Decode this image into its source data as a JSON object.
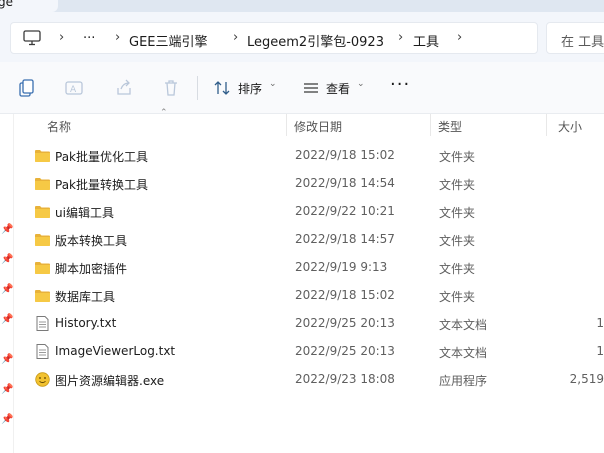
{
  "window": {
    "tab_title": "ge"
  },
  "address": {
    "more": "···",
    "crumbs": [
      "GEE三端引擎",
      "Legeem2引擎包-0923",
      "工具"
    ],
    "search_placeholder": "在 工具"
  },
  "toolbar": {
    "sort": "排序",
    "view": "查看",
    "more": "···"
  },
  "columns": {
    "name": "名称",
    "date": "修改日期",
    "type": "类型",
    "size": "大小"
  },
  "files": [
    {
      "icon": "folder-icon",
      "name": "Pak批量优化工具",
      "date": "2022/9/18 15:02",
      "type": "文件夹",
      "size": ""
    },
    {
      "icon": "folder-icon",
      "name": "Pak批量转换工具",
      "date": "2022/9/18 14:54",
      "type": "文件夹",
      "size": ""
    },
    {
      "icon": "folder-icon",
      "name": "ui编辑工具",
      "date": "2022/9/22 10:21",
      "type": "文件夹",
      "size": ""
    },
    {
      "icon": "folder-icon",
      "name": "版本转换工具",
      "date": "2022/9/18 14:57",
      "type": "文件夹",
      "size": ""
    },
    {
      "icon": "folder-icon",
      "name": "脚本加密插件",
      "date": "2022/9/19 9:13",
      "type": "文件夹",
      "size": ""
    },
    {
      "icon": "folder-icon",
      "name": "数据库工具",
      "date": "2022/9/18 15:02",
      "type": "文件夹",
      "size": ""
    },
    {
      "icon": "text-file-icon",
      "name": "History.txt",
      "date": "2022/9/25 20:13",
      "type": "文本文档",
      "size": "1"
    },
    {
      "icon": "text-file-icon",
      "name": "ImageViewerLog.txt",
      "date": "2022/9/25 20:13",
      "type": "文本文档",
      "size": "1"
    },
    {
      "icon": "app-icon",
      "name": "图片资源编辑器.exe",
      "date": "2022/9/23 18:08",
      "type": "应用程序",
      "size": "2,519"
    }
  ],
  "colors": {
    "folder": "#f3c641",
    "accent": "#0067c0",
    "toolbar_bg": "#f9fafc"
  }
}
